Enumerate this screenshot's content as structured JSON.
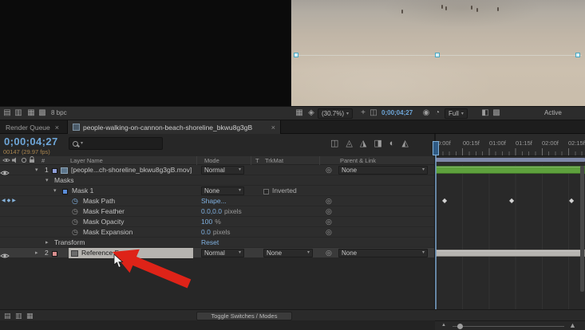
{
  "icons": {
    "chevron": "▾",
    "twirl_open": "▾",
    "twirl_closed": "▸",
    "stopwatch": "◷",
    "pickwhip": "◎",
    "keyframe": "◆",
    "kf_prev": "◀",
    "kf_next": "▶",
    "close": "×",
    "panel_1": "▤",
    "panel_2": "▥",
    "panel_3": "▦",
    "panel_4": "▩",
    "transparency_grid": "▦",
    "mask_visibility": "◈",
    "guides": "+",
    "region_of_interest": "◫",
    "snapshot": "◉",
    "show_channel": "◔",
    "roi2": "◧",
    "grid2": "▩",
    "flowchart": "◫",
    "draft3d": "◬",
    "shy": "◮",
    "frame_blend": "◨",
    "motion_blur": "◐",
    "graph_editor": "◭",
    "mtn_small": "▲",
    "mtn_large": "▲"
  },
  "viewer": {
    "bpc": "8 bpc",
    "zoom": "(30.7%)",
    "timecode": "0;00;04;27",
    "resolution": "Full",
    "view": "Active Camera"
  },
  "tabs": {
    "render_queue": "Render Queue",
    "active": "people-walking-on-cannon-beach-shoreline_bkwu8g3gB"
  },
  "search_value": "",
  "tl": {
    "timecode": "0;00;04;27",
    "frame_info": "00147 (29.97 fps)",
    "ruler": [
      "0:00f",
      "00:15f",
      "01:00f",
      "01:15f",
      "02:00f",
      "02:15f"
    ],
    "header": {
      "hash": "#",
      "layer_name": "Layer Name",
      "mode": "Mode",
      "t": "T",
      "trkmat": "TrkMat",
      "parent": "Parent & Link"
    },
    "layer1": {
      "num": "1",
      "name": "[people...ch-shoreline_bkwu8g3gB.mov]",
      "mode": "Normal",
      "parent": "None"
    },
    "masks_label": "Masks",
    "mask1": {
      "name": "Mask 1",
      "mode": "None",
      "inverted": "Inverted"
    },
    "mask_path": {
      "label": "Mask Path",
      "value": "Shape..."
    },
    "mask_feather": {
      "label": "Mask Feather",
      "value": "0.0,0.0",
      "unit": "pixels"
    },
    "mask_opacity": {
      "label": "Mask Opacity",
      "value": "100",
      "unit": "%"
    },
    "mask_expansion": {
      "label": "Mask Expansion",
      "value": "0.0",
      "unit": "pixels"
    },
    "transform": {
      "label": "Transform",
      "value": "Reset"
    },
    "layer2": {
      "num": "2",
      "name": "Reference Frame",
      "mode": "Normal",
      "trkmat": "None",
      "parent": "None"
    }
  },
  "bottom": {
    "toggle_label": "Toggle Switches / Modes"
  },
  "colors": {
    "timecode_blue": "#6ea6d8",
    "frame_info_orange": "#a8854f",
    "value_blue": "#7fb0e0",
    "layerbar_green": "#5ea13d",
    "selected_bar_gray": "#b7b5b1",
    "workarea_bar": "#7e88a8",
    "label_layer1": "#8f9fd9",
    "label_mask1": "#5b8dd9",
    "label_layer2": "#d98f8f",
    "arrow_red": "#de2318"
  }
}
